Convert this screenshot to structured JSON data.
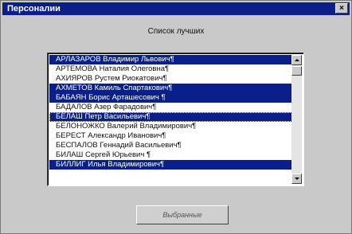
{
  "window": {
    "title": "Персоналии",
    "close_glyph": "×"
  },
  "list": {
    "title": "Список лучших",
    "items": [
      {
        "label": "АРЛАЗАРОВ Владимир Львович¶",
        "selected": true,
        "focused": false
      },
      {
        "label": "АРТЕМОВА Наталия Олеговна¶",
        "selected": false,
        "focused": false
      },
      {
        "label": "АХИЯРОВ Рустем Риокатович¶",
        "selected": false,
        "focused": false
      },
      {
        "label": "АХМЕТОВ Камиль Спартакович¶",
        "selected": true,
        "focused": false
      },
      {
        "label": "БАБАЯН Борис Арташесович ¶",
        "selected": true,
        "focused": false
      },
      {
        "label": "БАДАЛОВ Азер Фарадович¶",
        "selected": false,
        "focused": false
      },
      {
        "label": "БЕЛАШ Петр Васильевич¶",
        "selected": true,
        "focused": true
      },
      {
        "label": "БЕЛОНОЖКО Валерий Владимирович¶",
        "selected": false,
        "focused": false
      },
      {
        "label": "БЕРЕСТ Александр Иванович¶",
        "selected": false,
        "focused": false
      },
      {
        "label": "БЕСПАЛОВ Геннадий Васильевич¶",
        "selected": false,
        "focused": false
      },
      {
        "label": "БИЛАШ Сергей Юрьевич ¶",
        "selected": false,
        "focused": false
      },
      {
        "label": "БИЛЛИГ Илья Владимирович¶",
        "selected": true,
        "focused": false
      }
    ]
  },
  "action_button": {
    "label": "Выбранные"
  },
  "colors": {
    "selection": "#0b1f8a",
    "window_bg": "#c9c9c9"
  }
}
